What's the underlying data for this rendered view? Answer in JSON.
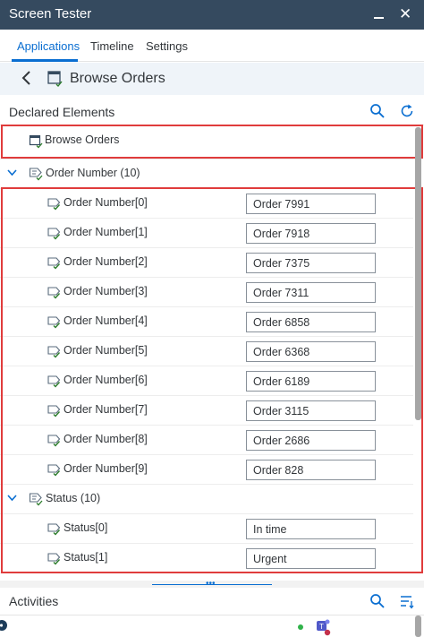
{
  "window": {
    "title": "Screen Tester"
  },
  "tabs": [
    {
      "label": "Applications",
      "active": true
    },
    {
      "label": "Timeline",
      "active": false
    },
    {
      "label": "Settings",
      "active": false
    }
  ],
  "nav": {
    "title": "Browse Orders"
  },
  "declared": {
    "title": "Declared Elements",
    "screen_item": "Browse Orders",
    "groups": [
      {
        "label": "Order Number (10)",
        "items": [
          {
            "label": "Order Number[0]",
            "value": "Order 7991"
          },
          {
            "label": "Order Number[1]",
            "value": "Order 7918"
          },
          {
            "label": "Order Number[2]",
            "value": "Order 7375"
          },
          {
            "label": "Order Number[3]",
            "value": "Order 7311"
          },
          {
            "label": "Order Number[4]",
            "value": "Order 6858"
          },
          {
            "label": "Order Number[5]",
            "value": "Order 6368"
          },
          {
            "label": "Order Number[6]",
            "value": "Order 6189"
          },
          {
            "label": "Order Number[7]",
            "value": "Order 3115"
          },
          {
            "label": "Order Number[8]",
            "value": "Order 2686"
          },
          {
            "label": "Order Number[9]",
            "value": "Order 828"
          }
        ]
      },
      {
        "label": "Status (10)",
        "items": [
          {
            "label": "Status[0]",
            "value": "In time"
          },
          {
            "label": "Status[1]",
            "value": "Urgent"
          }
        ]
      }
    ]
  },
  "activities": {
    "title": "Activities"
  },
  "colors": {
    "titlebar": "#354a5f",
    "accent": "#0a6ed1",
    "highlight": "#e03c3c",
    "check": "#2b7c2b"
  },
  "icons": {
    "back": "chevron-left-icon",
    "screen": "screen-icon",
    "search": "search-icon",
    "refresh": "refresh-icon",
    "collapse": "chevron-down-icon",
    "element": "element-check-icon",
    "group": "element-group-icon",
    "sort": "sort-icon"
  }
}
